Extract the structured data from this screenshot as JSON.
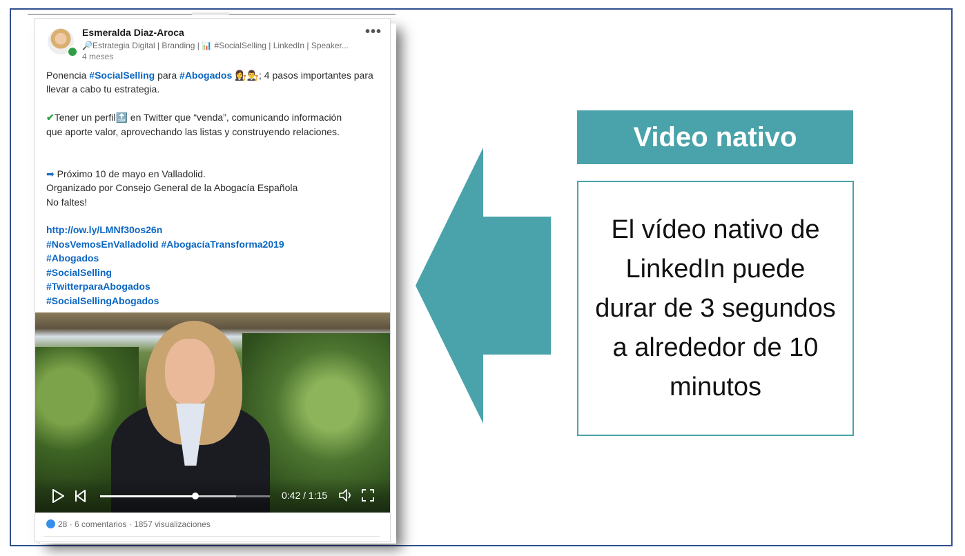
{
  "post": {
    "author_name": "Esmeralda Diaz-Aroca",
    "headline": "🔎Estrategia Digital | Branding | 📊 #SocialSelling | LinkedIn | Speaker...",
    "time": "4 meses",
    "more_label": "•••",
    "body": {
      "l1_a": "Ponencia ",
      "l1_tag1": "#SocialSelling",
      "l1_b": " para ",
      "l1_tag2": "#Abogados",
      "l1_c": " 👩‍⚖️👨‍⚖️; 4 pasos importantes para",
      "l2": "llevar a cabo tu estrategia.",
      "l3_check": "✔",
      "l3_a": "Tener un perfil",
      "l3_top": "🔝",
      "l3_b": " en Twitter que “venda”, comunicando información",
      "l4": "que aporte valor, aprovechando las listas y construyendo relaciones.",
      "l5_arrow": "➡",
      "l5": " Próximo 10 de mayo en Valladolid.",
      "l6": " Organizado por Consejo General de la Abogacía Española",
      "l7": "No faltes!",
      "link": "http://ow.ly/LMNf30os26n",
      "tags_line1": "#NosVemosEnValladolid #AbogacíaTransforma2019",
      "tag_a": "#Abogados",
      "tag_b": "#SocialSelling",
      "tag_c": "#TwitterparaAbogados",
      "tag_d": "#SocialSellingAbogados"
    },
    "video": {
      "time_label": "0:42 / 1:15",
      "progress": 0.56,
      "buffered": 0.8
    },
    "footer": {
      "reactions": "28",
      "dot1": " · ",
      "comments": "6 comentarios",
      "dot2": " · ",
      "views": "1857 visualizaciones"
    }
  },
  "callout": {
    "title": "Video nativo",
    "description": "El vídeo nativo de LinkedIn puede durar de 3 segundos a alrededor de 10 minutos"
  },
  "colors": {
    "accent": "#4aa3aa",
    "frame": "#2f4f8f",
    "linkedin_link": "#0a66c2"
  },
  "icons": [
    "avatar",
    "online-dot-icon",
    "more-icon",
    "play-icon",
    "previous-icon",
    "volume-icon",
    "fullscreen-icon",
    "like-icon",
    "arrow-left-icon"
  ]
}
